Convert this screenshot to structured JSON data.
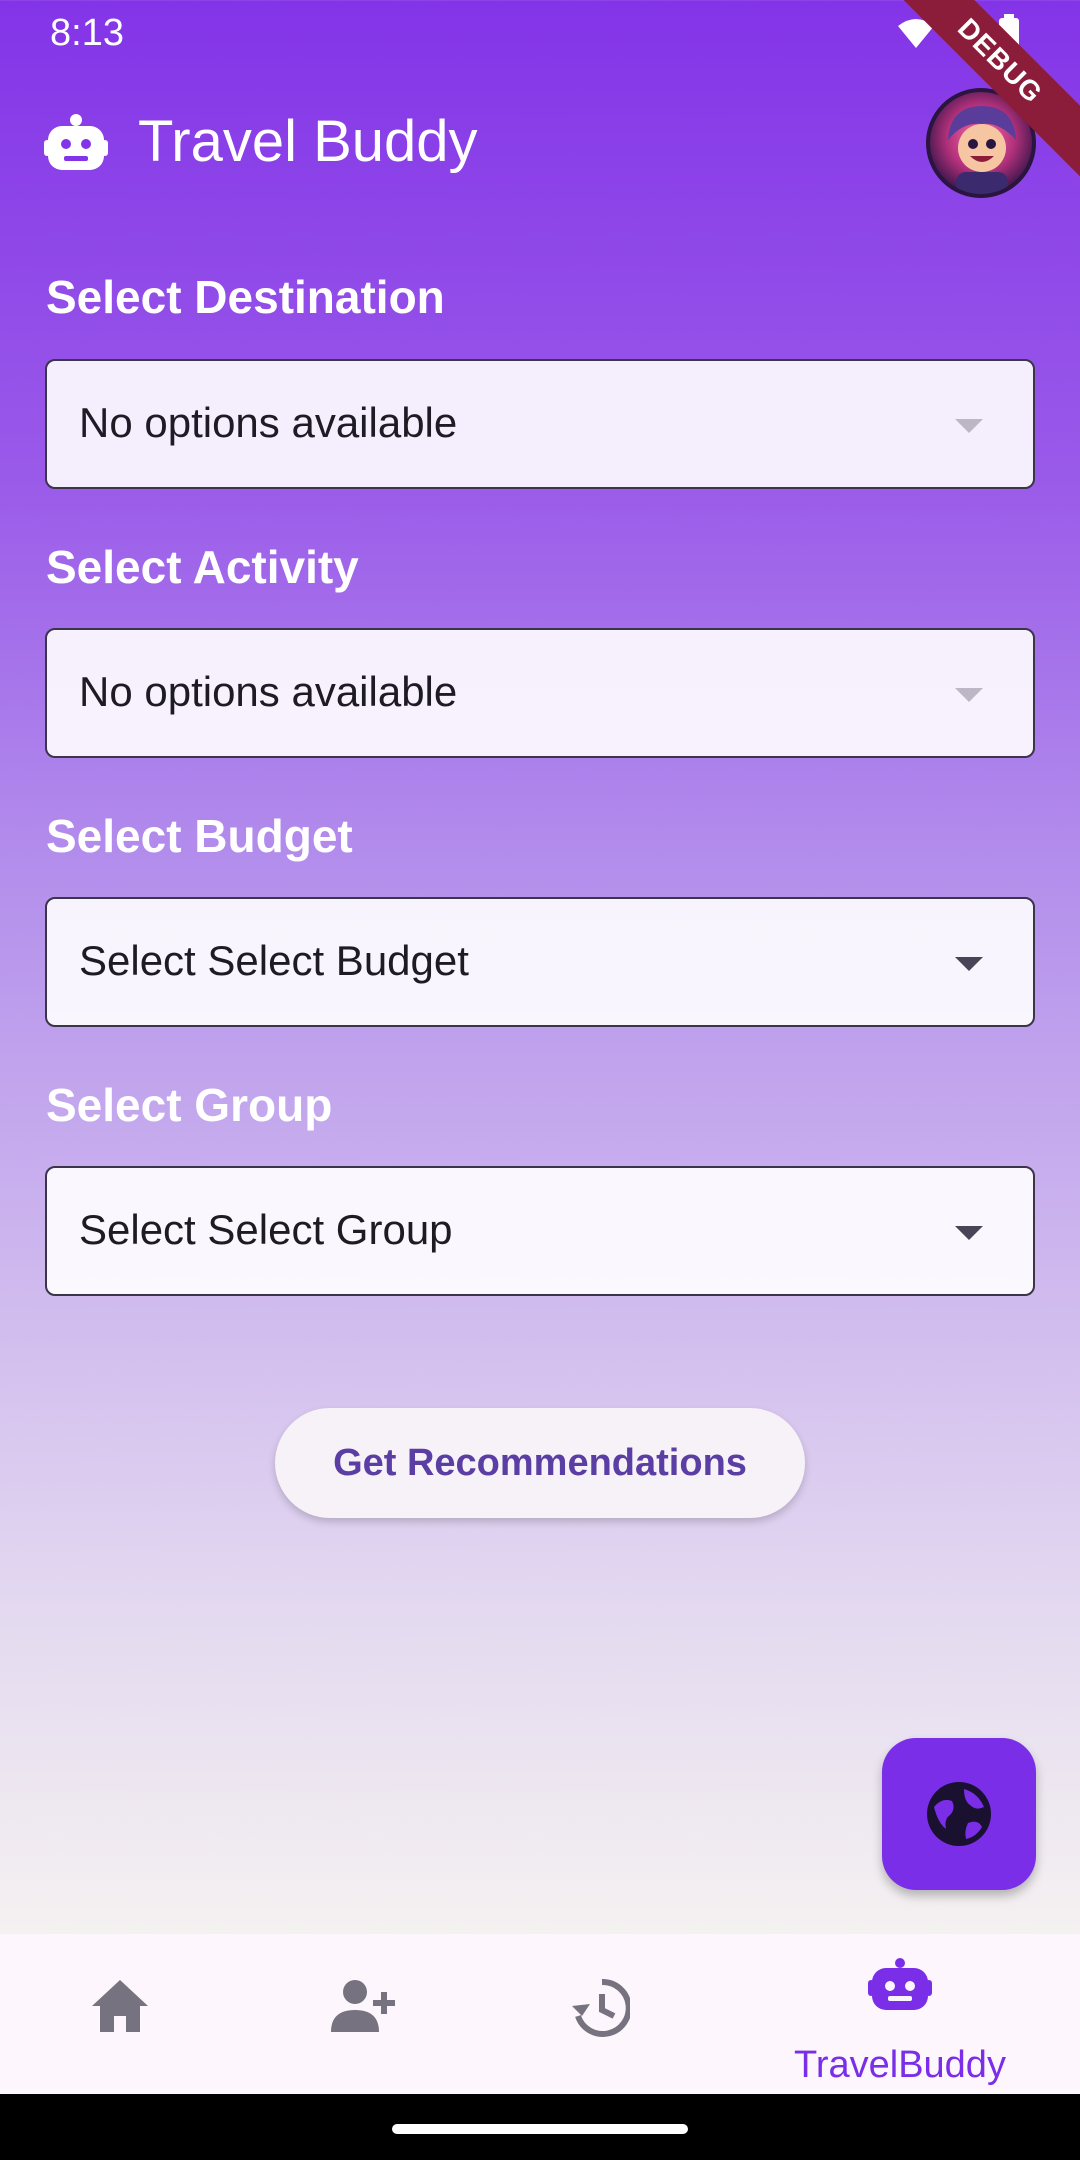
{
  "status_bar": {
    "time": "8:13"
  },
  "debug_banner": "DEBUG",
  "app_bar": {
    "title": "Travel Buddy"
  },
  "form": {
    "destination": {
      "label": "Select Destination",
      "value": "No options available",
      "enabled": false
    },
    "activity": {
      "label": "Select Activity",
      "value": "No options available",
      "enabled": false
    },
    "budget": {
      "label": "Select Budget",
      "value": "Select Select Budget",
      "enabled": true
    },
    "group": {
      "label": "Select Group",
      "value": "Select Select Group",
      "enabled": true
    }
  },
  "cta": {
    "label": "Get Recommendations"
  },
  "fab": {
    "icon": "globe-icon"
  },
  "bottom_nav": {
    "items": [
      {
        "icon": "home-icon",
        "label": ""
      },
      {
        "icon": "person-add-icon",
        "label": ""
      },
      {
        "icon": "history-icon",
        "label": ""
      },
      {
        "icon": "robot-icon",
        "label": "TravelBuddy",
        "selected": true
      }
    ]
  },
  "colors": {
    "primary": "#7a2ee8",
    "header_start": "#8334e8",
    "cta_text": "#5b3ea3"
  }
}
